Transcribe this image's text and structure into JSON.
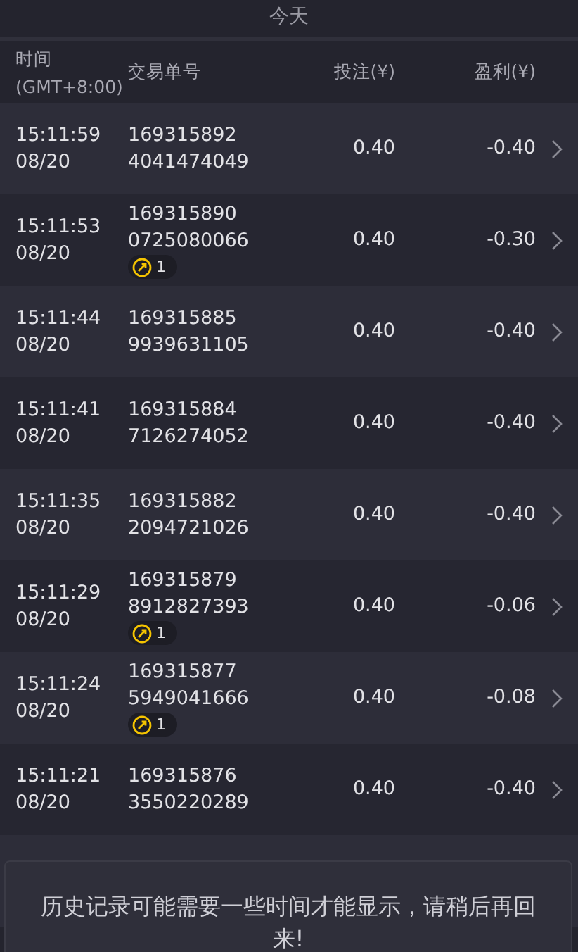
{
  "top_bar": {
    "title": "今天"
  },
  "columns": {
    "time": [
      "时间",
      "(GMT+8:00)"
    ],
    "order": "交易单号",
    "stake": "投注(¥)",
    "profit": "盈利(¥)"
  },
  "rows": [
    {
      "time": "15:11:59",
      "date": "08/20",
      "order_1": "169315892",
      "order_2": "4041474049",
      "stake": "0.40",
      "profit": "-0.40"
    },
    {
      "time": "15:11:53",
      "date": "08/20",
      "order_1": "169315890",
      "order_2": "0725080066",
      "badge": "1",
      "stake": "0.40",
      "profit": "-0.30"
    },
    {
      "time": "15:11:44",
      "date": "08/20",
      "order_1": "169315885",
      "order_2": "9939631105",
      "stake": "0.40",
      "profit": "-0.40"
    },
    {
      "time": "15:11:41",
      "date": "08/20",
      "order_1": "169315884",
      "order_2": "7126274052",
      "stake": "0.40",
      "profit": "-0.40"
    },
    {
      "time": "15:11:35",
      "date": "08/20",
      "order_1": "169315882",
      "order_2": "2094721026",
      "stake": "0.40",
      "profit": "-0.40"
    },
    {
      "time": "15:11:29",
      "date": "08/20",
      "order_1": "169315879",
      "order_2": "8912827393",
      "badge": "1",
      "stake": "0.40",
      "profit": "-0.06"
    },
    {
      "time": "15:11:24",
      "date": "08/20",
      "order_1": "169315877",
      "order_2": "5949041666",
      "badge": "1",
      "stake": "0.40",
      "profit": "-0.08"
    },
    {
      "time": "15:11:21",
      "date": "08/20",
      "order_1": "169315876",
      "order_2": "3550220289",
      "stake": "0.40",
      "profit": "-0.40"
    }
  ],
  "toast": "历史记录可能需要一些时间才能显示，请稍后再回来!"
}
